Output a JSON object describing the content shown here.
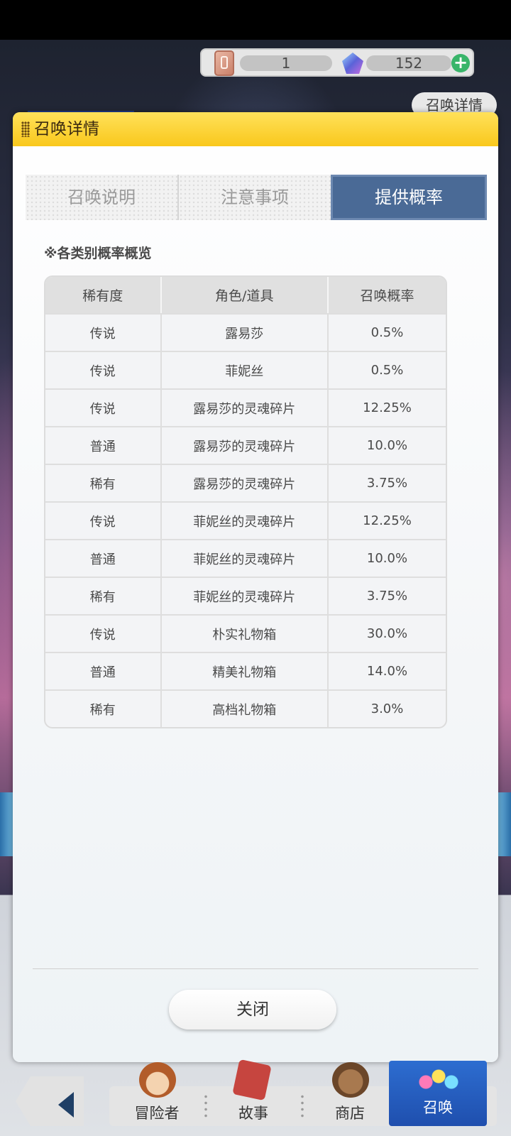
{
  "currency": {
    "tickets": "1",
    "gems": "152",
    "ticket_icon": "summon-ticket-icon",
    "gem_icon": "crystal-gem-icon",
    "plus_icon": "plus-icon"
  },
  "summon_detail_button": "召唤详情",
  "modal": {
    "title": "召唤详情",
    "tabs": [
      {
        "label": "召唤说明",
        "active": false
      },
      {
        "label": "注意事项",
        "active": false
      },
      {
        "label": "提供概率",
        "active": true
      }
    ],
    "section_heading": "※各类别概率概览",
    "table": {
      "headers": [
        "稀有度",
        "角色/道具",
        "召唤概率"
      ],
      "rows": [
        [
          "传说",
          "露易莎",
          "0.5%"
        ],
        [
          "传说",
          "菲妮丝",
          "0.5%"
        ],
        [
          "传说",
          "露易莎的灵魂碎片",
          "12.25%"
        ],
        [
          "普通",
          "露易莎的灵魂碎片",
          "10.0%"
        ],
        [
          "稀有",
          "露易莎的灵魂碎片",
          "3.75%"
        ],
        [
          "传说",
          "菲妮丝的灵魂碎片",
          "12.25%"
        ],
        [
          "普通",
          "菲妮丝的灵魂碎片",
          "10.0%"
        ],
        [
          "稀有",
          "菲妮丝的灵魂碎片",
          "3.75%"
        ],
        [
          "传说",
          "朴实礼物箱",
          "30.0%"
        ],
        [
          "普通",
          "精美礼物箱",
          "14.0%"
        ],
        [
          "稀有",
          "高档礼物箱",
          "3.0%"
        ]
      ]
    },
    "close_button": "关闭"
  },
  "bottom_nav": {
    "items": [
      {
        "label": "冒险者",
        "icon": "adventurer-icon"
      },
      {
        "label": "故事",
        "icon": "story-book-icon"
      },
      {
        "label": "商店",
        "icon": "shop-bag-icon"
      },
      {
        "label": "召唤",
        "icon": "summon-orbs-icon",
        "active": true
      }
    ]
  },
  "colors": {
    "header_yellow": "#f9c81c",
    "active_tab": "#4a6a96",
    "summon_nav": "#2d6dd0"
  }
}
